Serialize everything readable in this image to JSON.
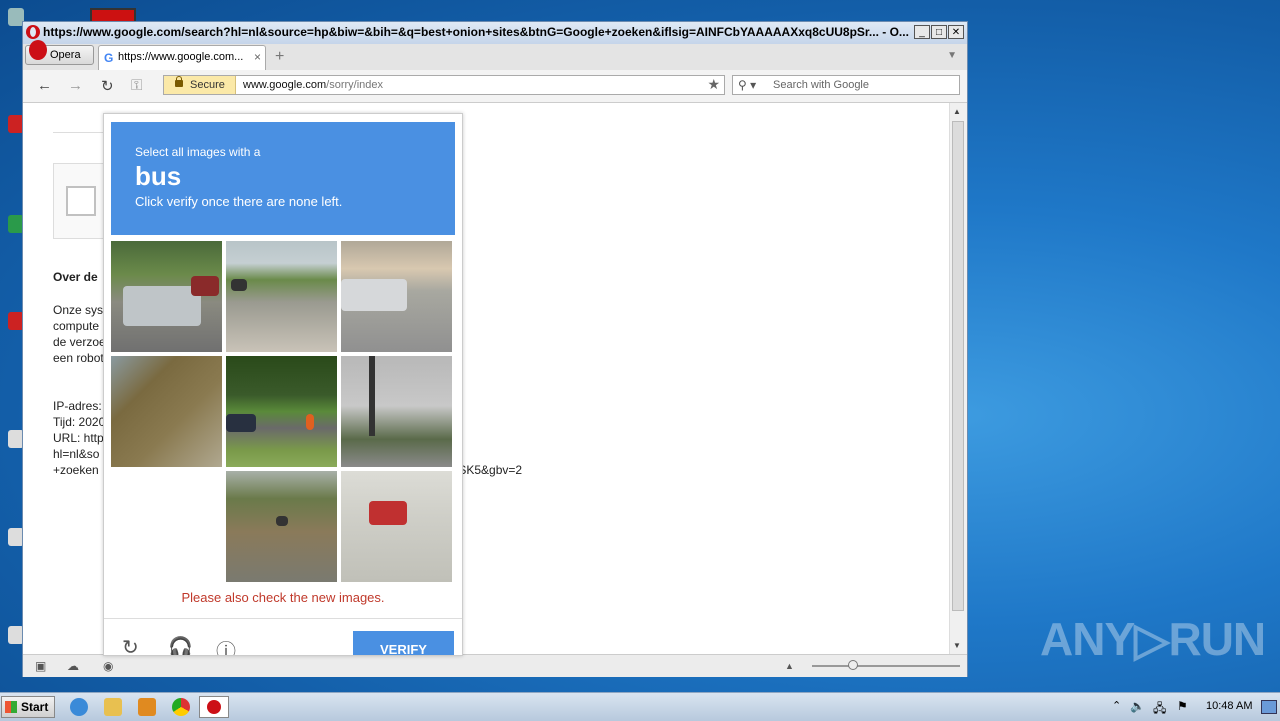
{
  "window": {
    "title": "https://www.google.com/search?hl=nl&source=hp&biw=&bih=&q=best+onion+sites&btnG=Google+zoeken&iflsig=AINFCbYAAAAAXxq8cUU8pSr... - O...",
    "minimize": "_",
    "maximize": "□",
    "close": "✕"
  },
  "tabs": {
    "opera_menu_label": "Opera",
    "active_tab_label": "https://www.google.com...",
    "close_tab": "×",
    "new_tab": "+"
  },
  "toolbar": {
    "back": "←",
    "forward": "→",
    "reload": "↻",
    "key": "⚿",
    "secure_label": "Secure",
    "url_domain": "www.google.com",
    "url_path": "/sorry/index",
    "bookmark_star": "★",
    "search_placeholder": "Search with Google",
    "search_icon": "⚲ ▾"
  },
  "page": {
    "heading": "Over de",
    "para1": "Onze sys",
    "para2": "compute",
    "para3": "de verzoe",
    "para4": "een robot",
    "ip": "IP-adres:",
    "time": "Tijd: 2020",
    "url": "URL: http",
    "url2": "hl=nl&so",
    "url3": "+zoeken",
    "url_tail": "/SK5&gbv=2"
  },
  "captcha": {
    "instruction_line1": "Select all images with a",
    "target_word": "bus",
    "instruction_line3": "Click verify once there are none left.",
    "message": "Please also check the new images.",
    "verify_label": "VERIFY",
    "reload_icon": "↻",
    "audio_icon": "🎧",
    "info_icon": "ⓘ"
  },
  "taskbar": {
    "start_label": "Start",
    "clock": "10:48 AM",
    "tray_up": "⌃"
  },
  "watermark": "ANY▷RUN"
}
